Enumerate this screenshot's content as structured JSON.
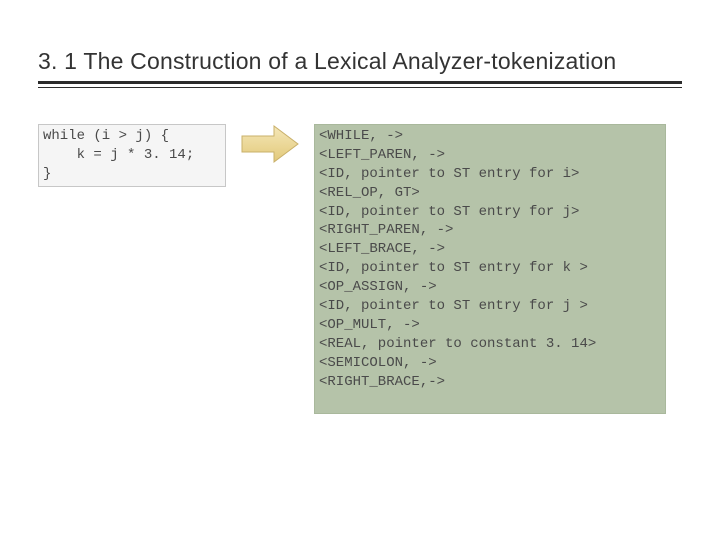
{
  "title": "3. 1 The Construction of a Lexical Analyzer-tokenization",
  "source_code": {
    "lines": [
      "while (i > j) {",
      "    k = j * 3. 14;",
      "}"
    ]
  },
  "tokens": {
    "lines": [
      "<WHILE, ->",
      "<LEFT_PAREN, ->",
      "<ID, pointer to ST entry for i>",
      "<REL_OP, GT>",
      "<ID, pointer to ST entry for j>",
      "<RIGHT_PAREN, ->",
      "<LEFT_BRACE, ->",
      "<ID, pointer to ST entry for k >",
      "<OP_ASSIGN, ->",
      "<ID, pointer to ST entry for j >",
      "<OP_MULT, ->",
      "<REAL, pointer to constant 3. 14>",
      "<SEMICOLON, ->",
      "<RIGHT_BRACE,->"
    ]
  },
  "arrow": {
    "semantic": "arrow-right",
    "fill_start": "#f5e7b8",
    "fill_end": "#e2c97a",
    "stroke": "#c9b06a"
  }
}
